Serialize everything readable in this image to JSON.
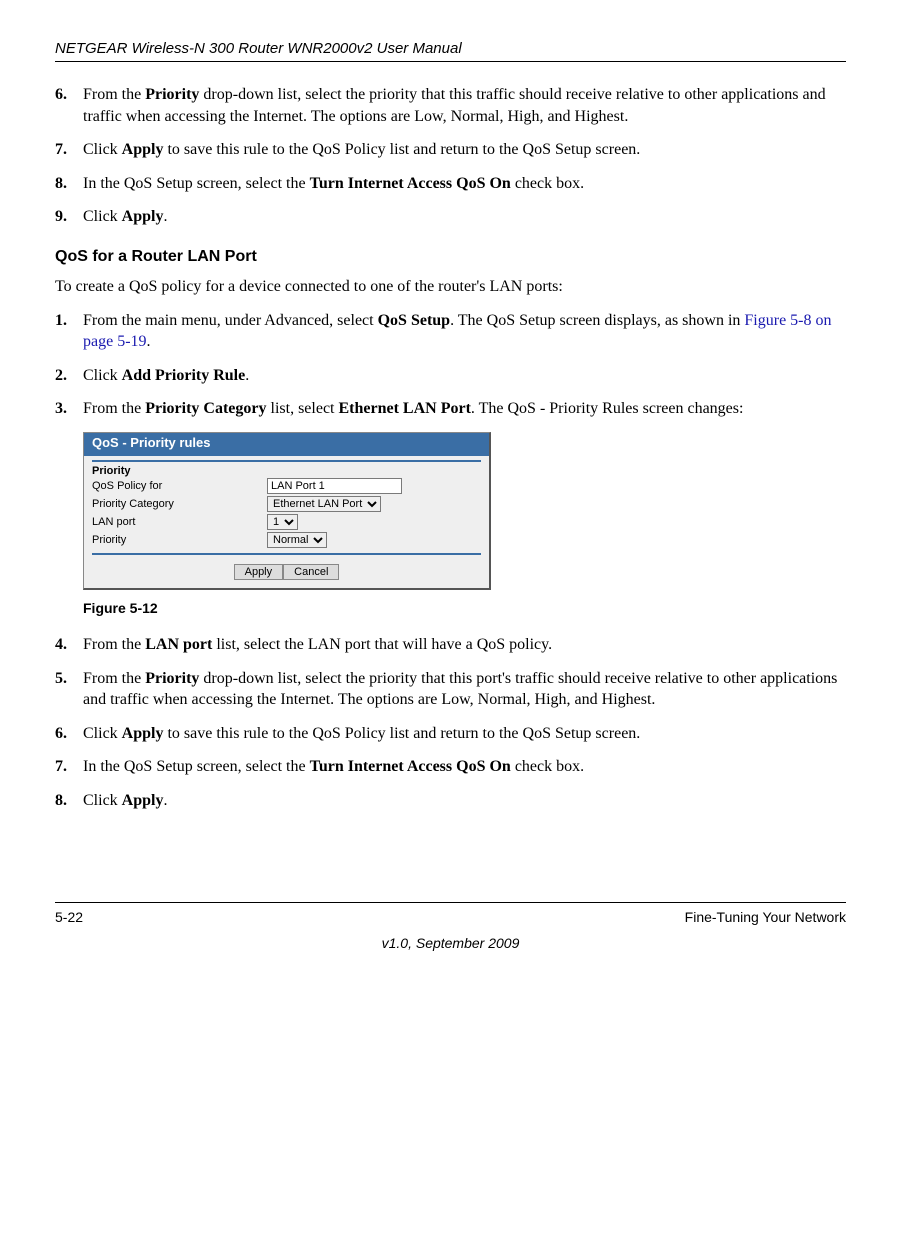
{
  "header": {
    "title": "NETGEAR Wireless-N 300 Router WNR2000v2 User Manual"
  },
  "steps_top": {
    "s6_num": "6.",
    "s6_a": "From the ",
    "s6_b": "Priority",
    "s6_c": " drop-down list, select the priority that this traffic should receive relative to other applications and traffic when accessing the Internet. The options are Low, Normal, High, and Highest.",
    "s7_num": "7.",
    "s7_a": "Click ",
    "s7_b": "Apply",
    "s7_c": " to save this rule to the QoS Policy list and return to the QoS Setup screen.",
    "s8_num": "8.",
    "s8_a": "In the QoS Setup screen, select the ",
    "s8_b": "Turn Internet Access QoS On",
    "s8_c": " check box.",
    "s9_num": "9.",
    "s9_a": "Click ",
    "s9_b": "Apply",
    "s9_c": "."
  },
  "section2": {
    "heading": "QoS for a Router LAN Port",
    "intro": "To create a QoS policy for a device connected to one of the router's LAN ports:",
    "s1_num": "1.",
    "s1_a": "From the main menu, under Advanced, select ",
    "s1_b": "QoS Setup",
    "s1_c": ". The QoS Setup screen displays, as shown in ",
    "s1_link": "Figure 5-8 on page 5-19",
    "s1_d": ".",
    "s2_num": "2.",
    "s2_a": "Click ",
    "s2_b": "Add Priority Rule",
    "s2_c": ".",
    "s3_num": "3.",
    "s3_a": "From the ",
    "s3_b": "Priority Category",
    "s3_c": " list, select ",
    "s3_d": "Ethernet LAN Port",
    "s3_e": ". The QoS - Priority Rules screen changes:"
  },
  "screenshot": {
    "title": "QoS - Priority rules",
    "section_label": "Priority",
    "row1_label": "QoS Policy for",
    "row1_value": "LAN Port 1",
    "row2_label": "Priority Category",
    "row2_value": "Ethernet LAN Port",
    "row3_label": "LAN port",
    "row3_value": "1",
    "row4_label": "Priority",
    "row4_value": "Normal",
    "btn_apply": "Apply",
    "btn_cancel": "Cancel"
  },
  "figure_caption": "Figure 5-12",
  "steps_bottom": {
    "s4_num": "4.",
    "s4_a": "From the ",
    "s4_b": "LAN port",
    "s4_c": " list, select the LAN port that will have a QoS policy.",
    "s5_num": "5.",
    "s5_a": "From the ",
    "s5_b": "Priority",
    "s5_c": " drop-down list, select the priority that this port's traffic should receive relative to other applications and traffic when accessing the Internet. The options are Low, Normal, High, and Highest.",
    "s6_num": "6.",
    "s6_a": "Click ",
    "s6_b": "Apply",
    "s6_c": " to save this rule to the QoS Policy list and return to the QoS Setup screen.",
    "s7_num": "7.",
    "s7_a": "In the QoS Setup screen, select the ",
    "s7_b": "Turn Internet Access QoS On",
    "s7_c": " check box.",
    "s8_num": "8.",
    "s8_a": "Click ",
    "s8_b": "Apply",
    "s8_c": "."
  },
  "footer": {
    "page_num": "5-22",
    "section_name": "Fine-Tuning Your Network",
    "version": "v1.0, September 2009"
  }
}
